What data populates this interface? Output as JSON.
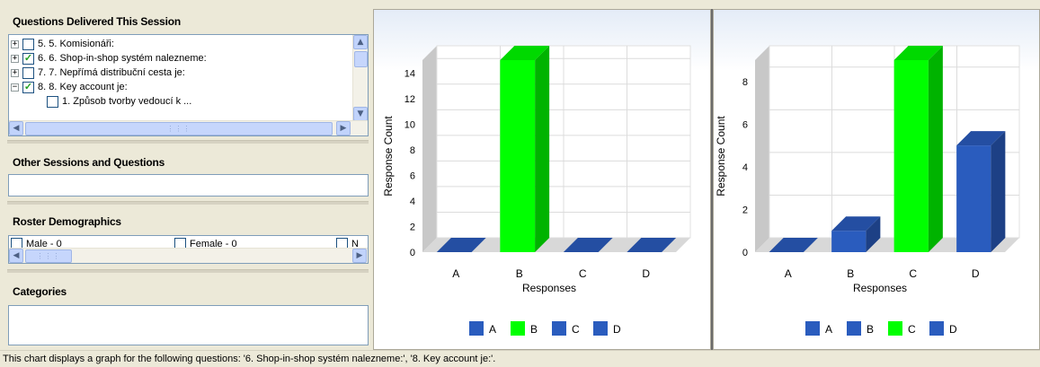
{
  "left_panel": {
    "questions_title": "Questions Delivered This Session",
    "questions": [
      {
        "expander": "+",
        "checked": false,
        "label": "5. 5. Komisionáři:"
      },
      {
        "expander": "+",
        "checked": true,
        "label": "6. 6. Shop-in-shop systém nalezneme:"
      },
      {
        "expander": "+",
        "checked": false,
        "label": "7. 7. Nepřímá distribuční cesta je:"
      },
      {
        "expander": "−",
        "checked": true,
        "label": "8. 8. Key account je:"
      },
      {
        "expander": "",
        "checked": false,
        "label": "1. Způsob tvorby vedoucí k ..."
      }
    ],
    "other_sessions_title": "Other Sessions and Questions",
    "roster_title": "Roster Demographics",
    "roster_items": [
      {
        "label": "Male - 0",
        "checked": false
      },
      {
        "label": "Female - 0",
        "checked": false
      },
      {
        "label": "N",
        "checked": false
      }
    ],
    "categories_title": "Categories"
  },
  "charts_colors": {
    "blue": "#2a5cbe",
    "green": "#00ff00"
  },
  "chart_data": [
    {
      "type": "bar",
      "categories": [
        "A",
        "B",
        "C",
        "D"
      ],
      "values": [
        0,
        15,
        0,
        0
      ],
      "highlight": "B",
      "xlabel": "Responses",
      "ylabel": "Response Count",
      "ylim": [
        0,
        15
      ],
      "yticks": [
        0,
        2,
        4,
        6,
        8,
        10,
        12,
        14
      ],
      "legend": [
        "A",
        "B",
        "C",
        "D"
      ],
      "legend_position": "bottom",
      "grid": true
    },
    {
      "type": "bar",
      "categories": [
        "A",
        "B",
        "C",
        "D"
      ],
      "values": [
        0,
        1,
        9,
        5
      ],
      "highlight": "C",
      "xlabel": "Responses",
      "ylabel": "Response Count",
      "ylim": [
        0,
        9
      ],
      "yticks": [
        0,
        2,
        4,
        6,
        8
      ],
      "legend": [
        "A",
        "B",
        "C",
        "D"
      ],
      "legend_position": "bottom",
      "grid": true
    }
  ],
  "status_bar": {
    "text": "This chart displays a graph for the following questions: '6. Shop-in-shop systém nalezneme:', '8. Key account je:'."
  }
}
